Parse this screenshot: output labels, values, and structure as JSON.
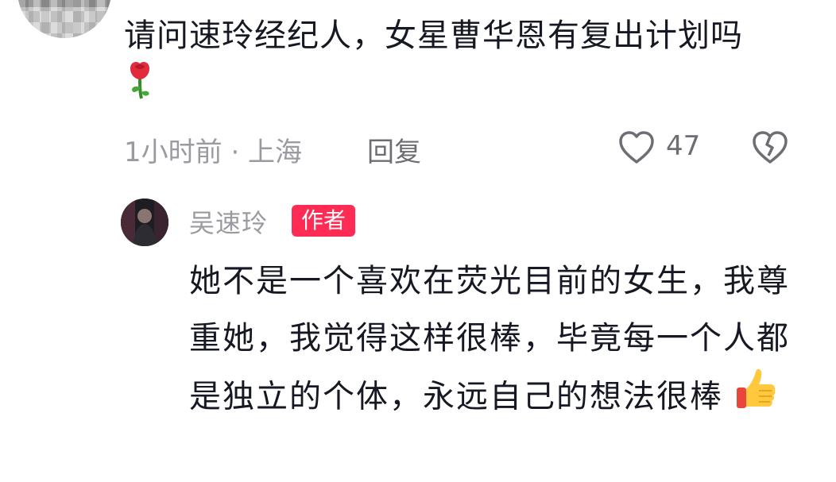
{
  "comment": {
    "text": "请问速玲经纪人，女星曹华恩有复出计划吗",
    "emoji": "rose-emoji",
    "time_location": "1小时前 · 上海",
    "reply_label": "回复",
    "like_count": "47"
  },
  "reply": {
    "author_name": "吴速玲",
    "author_tag": "作者",
    "text": "她不是一个喜欢在荧光目前的女生，我尊重她，我觉得这样很棒，毕竟每一个人都是独立的个体，永远自己的想法很棒",
    "emoji": "thumbs-up-emoji"
  },
  "colors": {
    "accent": "#fe2c55",
    "meta_text": "#9a9ba0",
    "body_text": "#161823"
  },
  "icons": [
    "heart-outline-icon",
    "broken-heart-outline-icon"
  ]
}
